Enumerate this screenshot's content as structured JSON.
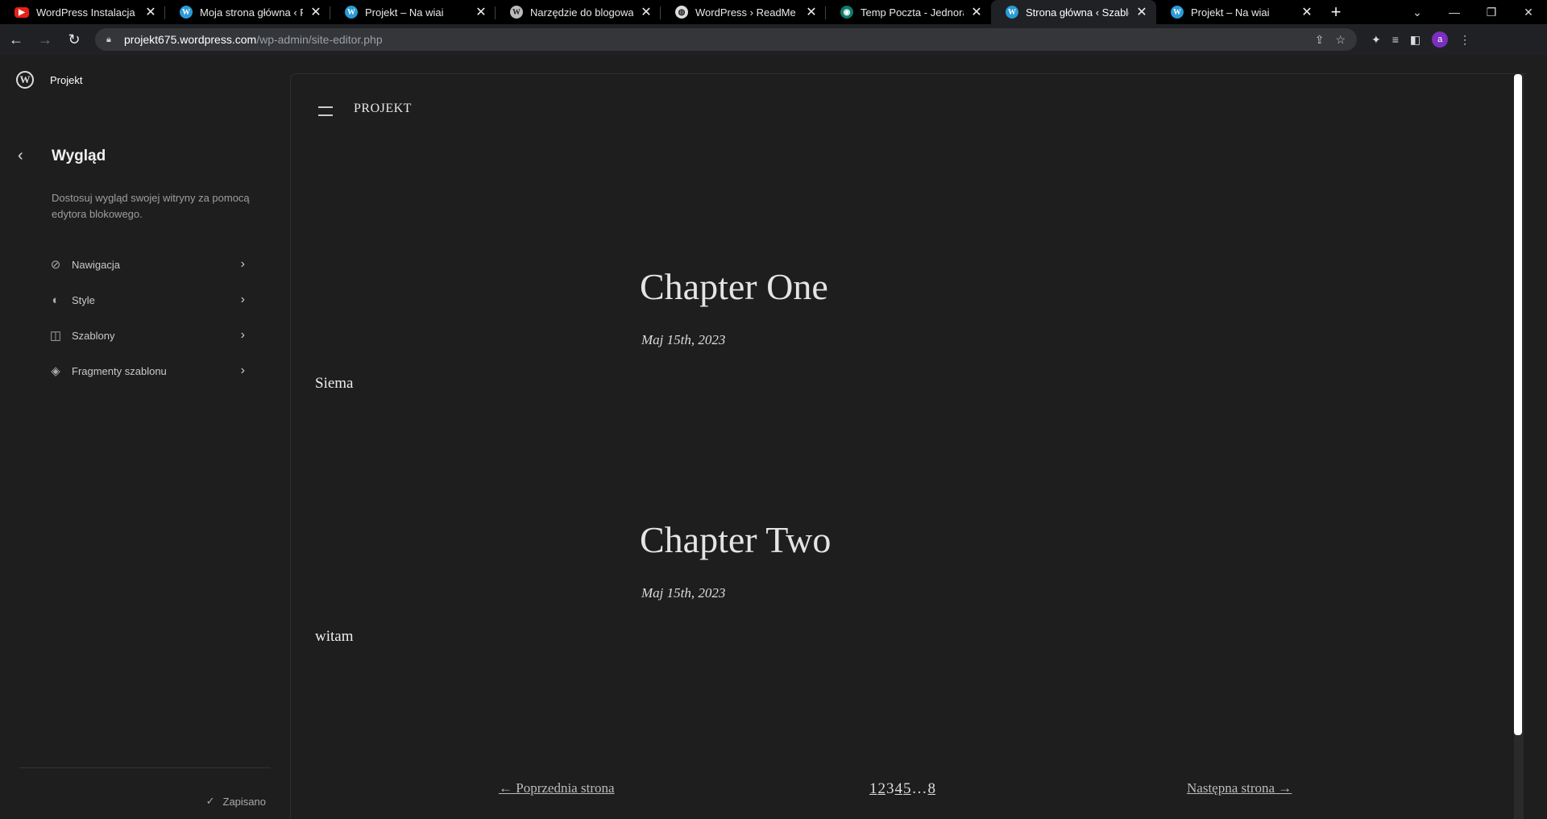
{
  "browser": {
    "tabs": [
      {
        "title": "WordPress Instalacja Porad",
        "favicon": "youtube-icon"
      },
      {
        "title": "Moja strona główna ‹ Proj",
        "favicon": "wordpress-icon"
      },
      {
        "title": "Projekt – Na wiai",
        "favicon": "wordpress-icon"
      },
      {
        "title": "Narzędzie do blogowania,",
        "favicon": "wordpress-icon"
      },
      {
        "title": "WordPress › ReadMe",
        "favicon": "globe-icon"
      },
      {
        "title": "Temp Poczta - Jednorazow",
        "favicon": "tempmail-icon"
      },
      {
        "title": "Strona główna ‹ Szablon ‹",
        "favicon": "wordpress-icon",
        "active": true
      },
      {
        "title": "Projekt – Na wiai",
        "favicon": "wordpress-icon"
      }
    ],
    "url_host": "projekt675.wordpress.com",
    "url_path": "/wp-admin/site-editor.php",
    "profile_initial": "a"
  },
  "sidebar": {
    "site_name": "Projekt",
    "title": "Wygląd",
    "description": "Dostosuj wygląd swojej witryny za pomocą edytora blokowego.",
    "items": [
      {
        "label": "Nawigacja",
        "icon": "compass-icon"
      },
      {
        "label": "Style",
        "icon": "half-circle-icon"
      },
      {
        "label": "Szablony",
        "icon": "layout-icon"
      },
      {
        "label": "Fragmenty szablonu",
        "icon": "diamond-icon"
      }
    ],
    "status": "Zapisano"
  },
  "canvas": {
    "site_title": "PROJEKT",
    "posts": [
      {
        "title": "Chapter One",
        "date": "Maj 15th, 2023",
        "excerpt": "Siema"
      },
      {
        "title": "Chapter Two",
        "date": "Maj 15th, 2023",
        "excerpt": "witam"
      }
    ],
    "pagination": {
      "prev": "← Poprzednia strona",
      "pages": [
        "1",
        "2",
        "3",
        "4",
        "5",
        "…",
        "8"
      ],
      "next": "Następna strona →"
    }
  }
}
